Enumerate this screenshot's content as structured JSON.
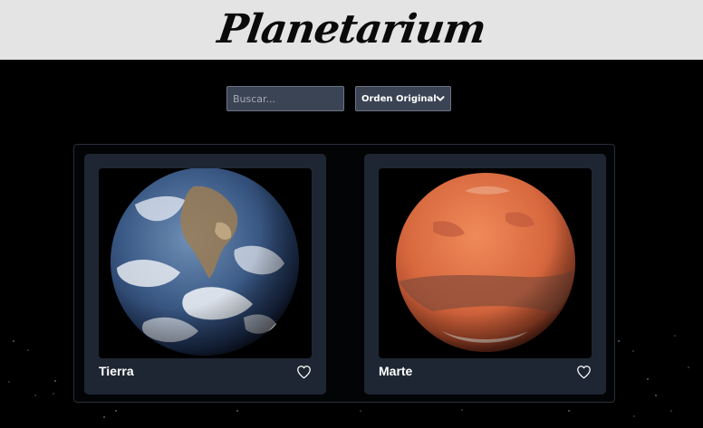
{
  "header": {
    "logo_text": "Planetarium"
  },
  "controls": {
    "search_placeholder": "Buscar...",
    "search_value": "",
    "order_selected": "Orden Original"
  },
  "planets": [
    {
      "name": "Tierra",
      "favorite": false
    },
    {
      "name": "Marte",
      "favorite": false
    }
  ],
  "colors": {
    "header_bg": "#e4e4e4",
    "page_bg": "#000000",
    "card_bg": "#1f2633",
    "control_bg": "#3b4454"
  },
  "icons": {
    "favorite": "heart-outline-icon",
    "select": "chevron-down-icon"
  }
}
